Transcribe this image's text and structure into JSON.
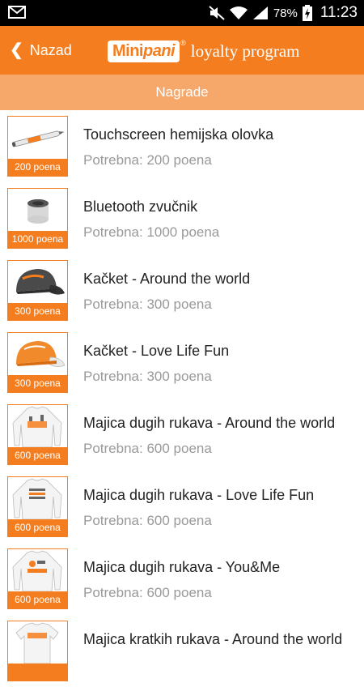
{
  "status_bar": {
    "battery": "78%",
    "time": "11:23"
  },
  "header": {
    "back_label": "Nazad",
    "brand_mini": "Mini",
    "brand_pani": "pani",
    "brand_reg": "®",
    "brand_tagline": "loyalty program"
  },
  "subheader": {
    "title": "Nagrade"
  },
  "rewards": [
    {
      "name": " Touchscreen hemijska olovka",
      "required": "Potrebna: 200 poena",
      "price": "200 poena",
      "icon": "pen"
    },
    {
      "name": "Bluetooth zvučnik",
      "required": "Potrebna: 1000 poena",
      "price": "1000 poena",
      "icon": "speaker"
    },
    {
      "name": "Kačket - Around the world",
      "required": "Potrebna: 300 poena",
      "price": "300 poena",
      "icon": "cap-dark"
    },
    {
      "name": "Kačket - Love Life Fun",
      "required": "Potrebna: 300 poena",
      "price": "300 poena",
      "icon": "cap-orange"
    },
    {
      "name": "Majica dugih rukava - Around the world",
      "required": "Potrebna: 600 poena",
      "price": "600 poena",
      "icon": "longsleeve-shirt"
    },
    {
      "name": "Majica dugih rukava - Love Life Fun",
      "required": "Potrebna: 600 poena",
      "price": "600 poena",
      "icon": "longsleeve-shirt"
    },
    {
      "name": "Majica dugih rukava - You&Me",
      "required": "Potrebna: 600 poena",
      "price": "600 poena",
      "icon": "longsleeve-shirt"
    },
    {
      "name": "Majica kratkih rukava - Around the world",
      "required": "",
      "price": "",
      "icon": "tshirt"
    }
  ],
  "colors": {
    "accent": "#f47e1f",
    "subheader": "#f6a76a",
    "muted": "#999999"
  }
}
